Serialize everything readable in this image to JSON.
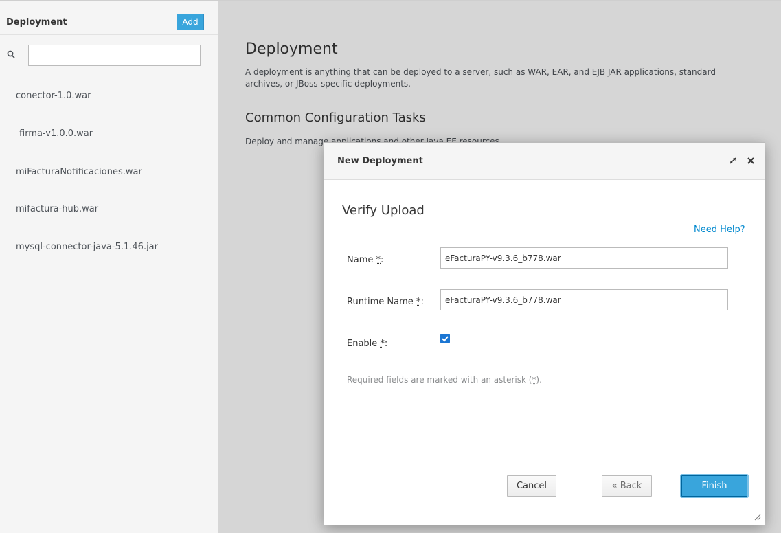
{
  "sidebar": {
    "title": "Deployment",
    "add_label": "Add",
    "search_placeholder": "",
    "items": [
      {
        "label": "conector-1.0.war"
      },
      {
        "label": "firma-v1.0.0.war"
      },
      {
        "label": "miFacturaNotificaciones.war"
      },
      {
        "label": "mifactura-hub.war"
      },
      {
        "label": "mysql-connector-java-5.1.46.jar"
      }
    ]
  },
  "main": {
    "title": "Deployment",
    "description": "A deployment is anything that can be deployed to a server, such as WAR, EAR, and EJB JAR applications, standard archives, or JBoss-specific deployments.",
    "subtitle": "Common Configuration Tasks",
    "subdescription": "Deploy and manage applications and other Java EE resources."
  },
  "dialog": {
    "title": "New Deployment",
    "step_title": "Verify Upload",
    "help_label": "Need Help?",
    "fields": {
      "name_label": "Name",
      "name_value": "eFacturaPY-v9.3.6_b778.war",
      "runtime_label": "Runtime Name",
      "runtime_value": "eFacturaPY-v9.3.6_b778.war",
      "enable_label": "Enable",
      "enable_checked": true
    },
    "required_marker": "*",
    "required_note_prefix": "Required fields are marked with an asterisk (",
    "required_note_suffix": ").",
    "buttons": {
      "cancel": "Cancel",
      "back": "« Back",
      "finish": "Finish"
    }
  },
  "colors": {
    "accent": "#39a5dc",
    "link": "#0088ce",
    "checkbox": "#1b76d3"
  },
  "icons": {
    "search": "search-icon",
    "maximize": "maximize-icon",
    "close": "close-icon",
    "check": "check-icon",
    "resize": "resize-grip-icon"
  }
}
